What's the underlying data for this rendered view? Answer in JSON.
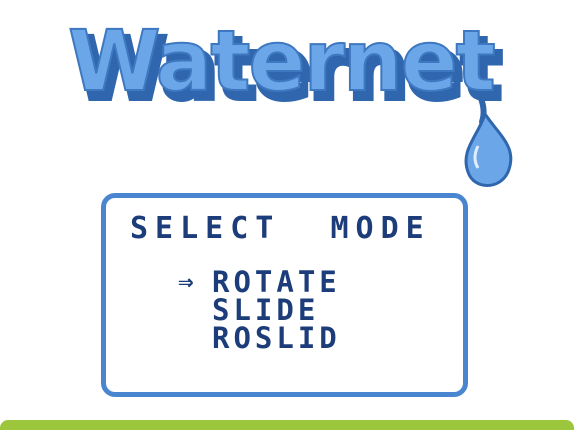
{
  "logo": {
    "text": "Waternet"
  },
  "menu": {
    "title": "SELECT  MODE",
    "cursor_glyph": "⇒",
    "selected_index": 0,
    "options": [
      {
        "label": "ROTATE"
      },
      {
        "label": "SLIDE"
      },
      {
        "label": "ROSLID"
      }
    ]
  },
  "colors": {
    "background": "#ffffff",
    "logo_fill": "#6aa6e8",
    "logo_shadow": "#2f66ad",
    "text": "#1c3d7a",
    "box_border": "#4a86cf",
    "screen_edge": "#9cc63c"
  }
}
